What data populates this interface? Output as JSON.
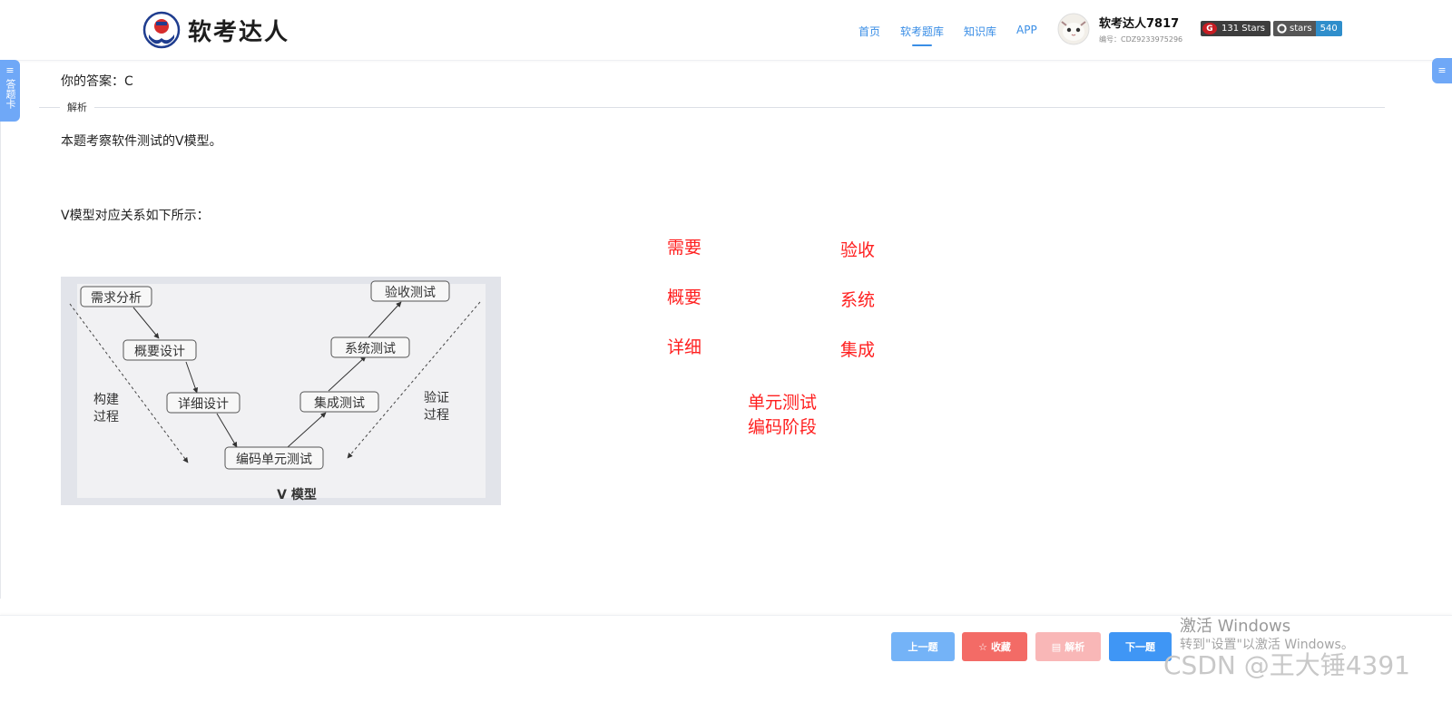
{
  "header": {
    "logo_text": "软考达人",
    "nav": [
      {
        "label": "首页"
      },
      {
        "label": "软考题库"
      },
      {
        "label": "知识库"
      },
      {
        "label": "APP"
      }
    ],
    "user": {
      "name": "软考达人7817",
      "id": "编号：CDZ9233975296"
    },
    "badges": {
      "gitee_label": "131 Stars",
      "github_label": "stars",
      "github_count": "540"
    }
  },
  "side": {
    "left_tab": "答题卡"
  },
  "content": {
    "answer": "你的答案：C",
    "section_label": "解析",
    "para1": "本题考察软件测试的V模型。",
    "para2": "V模型对应关系如下所示："
  },
  "figure": {
    "boxes": [
      "需求分析",
      "概要设计",
      "详细设计",
      "编码单元测试",
      "集成测试",
      "系统测试",
      "验收测试"
    ],
    "left_label": [
      "构建",
      "过程"
    ],
    "right_label": [
      "验证",
      "过程"
    ],
    "caption": "V 模型"
  },
  "annotations": {
    "left": [
      "需要",
      "概要",
      "详细"
    ],
    "right": [
      "验收",
      "系统",
      "集成"
    ],
    "bottom": [
      "单元测试",
      "编码阶段"
    ]
  },
  "footer": {
    "prev": "上一题",
    "favorite": "收藏",
    "analysis": "解析",
    "next": "下一题"
  },
  "watermark": {
    "line1": "激活 Windows",
    "line2": "转到\"设置\"以激活 Windows。",
    "csdn": "CSDN @王大锤4391"
  },
  "colors": {
    "accent": "#3a8ee6",
    "annotation": "#ff1f1f",
    "fav": "#f36b66",
    "next": "#3f96f5"
  }
}
